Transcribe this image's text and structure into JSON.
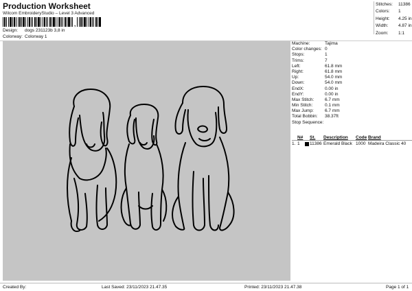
{
  "header": {
    "title": "Production Worksheet",
    "subtitle": "Wilcom EmbroideryStudio – Level 3 Advanced",
    "barcode_suffix": ","
  },
  "meta": {
    "design_label": "Design:",
    "design_value": "dogs 231123b 3,8 in",
    "colorway_label": "Colorway:",
    "colorway_value": "Colorway 1"
  },
  "stats": [
    {
      "label": "Stitches:",
      "value": "11386"
    },
    {
      "label": "Colors:",
      "value": "1"
    },
    {
      "label": "Height:",
      "value": "4.25 in"
    },
    {
      "label": "Width:",
      "value": "4.87 in"
    },
    {
      "label": "Zoom:",
      "value": "1:1"
    }
  ],
  "details": [
    {
      "label": "Machine:",
      "value": "Tajima"
    },
    {
      "label": "Color changes:",
      "value": "0"
    },
    {
      "label": "Stops:",
      "value": "1"
    },
    {
      "label": "Trims:",
      "value": "7"
    },
    {
      "label": "Left:",
      "value": "61.8 mm"
    },
    {
      "label": "Right:",
      "value": "61.8 mm"
    },
    {
      "label": "Up:",
      "value": "54.0 mm"
    },
    {
      "label": "Down:",
      "value": "54.0 mm"
    },
    {
      "label": "EndX:",
      "value": "0.00 in"
    },
    {
      "label": "EndY:",
      "value": "0.00 in"
    },
    {
      "label": "Max Stitch:",
      "value": "6.7 mm"
    },
    {
      "label": "Min Stitch:",
      "value": "0.1 mm"
    },
    {
      "label": "Max Jump:",
      "value": "6.7 mm"
    },
    {
      "label": "Total Bobbin:",
      "value": "38.37ft"
    }
  ],
  "stop_sequence": {
    "title": "Stop Sequence:",
    "headers": {
      "n": "N#",
      "st": "St.",
      "description": "Description",
      "code": "Code",
      "brand": "Brand"
    },
    "rows": [
      {
        "index": "1.",
        "n": "1",
        "swatch_color": "#000000",
        "st": "11386",
        "description": "Emerald Black",
        "code": "1000",
        "brand": "Madeira Classic 40"
      }
    ]
  },
  "footer": {
    "created_by": "Created By:",
    "last_saved": "Last Saved: 23/11/2023 21.47.35",
    "printed": "Printed: 23/11/2023 21.47.38",
    "page": "Page 1 of 1"
  },
  "colors": {
    "canvas_bg": "#c5c5c5",
    "thread": "#000000"
  },
  "canvas": {
    "content": "embroidery line art of three seated dogs"
  }
}
